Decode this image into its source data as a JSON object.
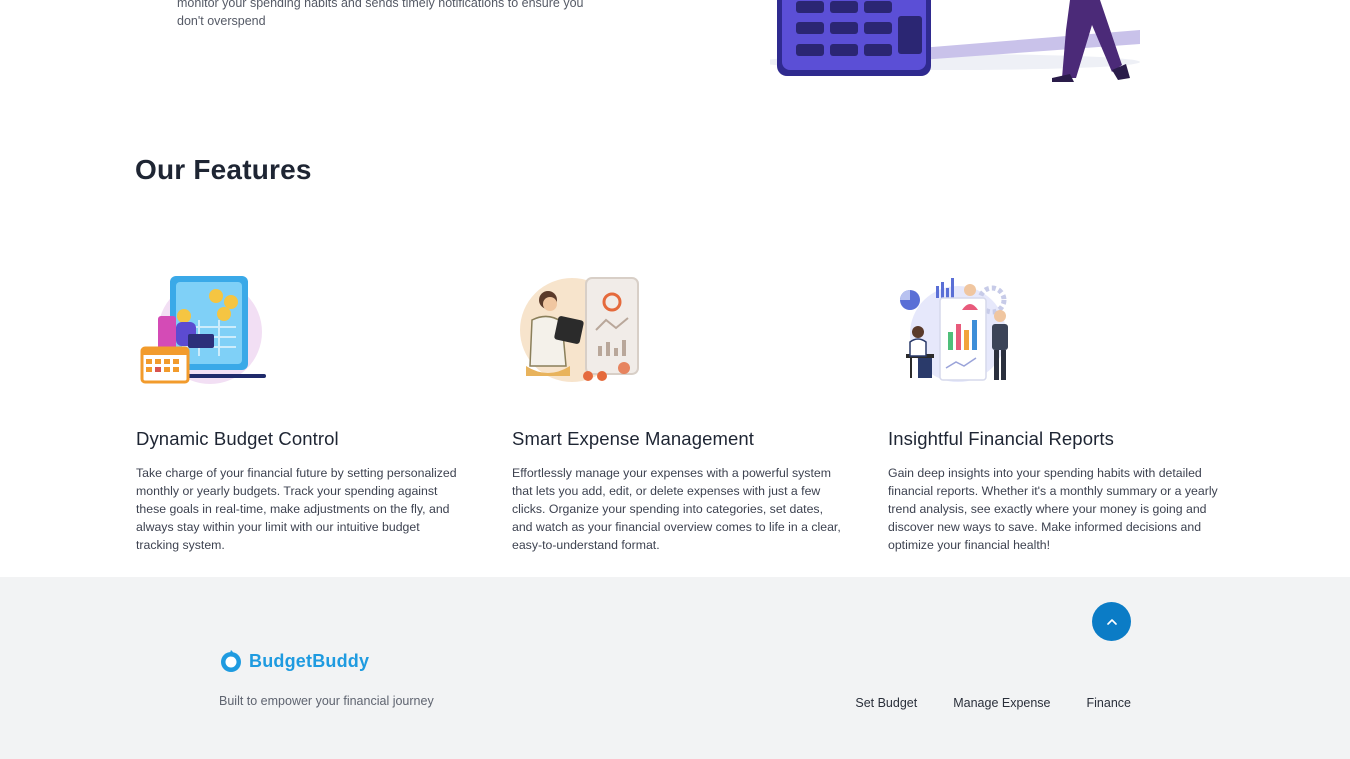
{
  "hero": {
    "text": "monitor your spending habits and sends timely notifications to ensure you don't overspend"
  },
  "features": {
    "title": "Our Features",
    "items": [
      {
        "title": "Dynamic Budget Control",
        "description": "Take charge of your financial future by setting personalized monthly or yearly budgets. Track your spending against these goals in real-time, make adjustments on the fly, and always stay within your limit with our intuitive budget tracking system.",
        "icon": "budget-calendar-illustration"
      },
      {
        "title": "Smart Expense Management",
        "description": "Effortlessly manage your expenses with a powerful system that lets you add, edit, or delete expenses with just a few clicks. Organize your spending into categories, set dates, and watch as your financial overview comes to life in a clear, easy-to-understand format.",
        "icon": "expense-tablet-illustration"
      },
      {
        "title": "Insightful Financial Reports",
        "description": "Gain deep insights into your spending habits with detailed financial reports. Whether it's a monthly summary or a yearly trend analysis, see exactly where your money is going and discover new ways to save. Make informed decisions and optimize your financial health!",
        "icon": "reports-chart-illustration"
      }
    ]
  },
  "footer": {
    "brand": "BudgetBuddy",
    "tagline": "Built to empower your financial journey",
    "links": [
      "Set Budget",
      "Manage Expense",
      "Finance"
    ],
    "back_to_top_icon": "chevron-up-icon"
  },
  "colors": {
    "brand": "#1f9be0",
    "back_to_top": "#0b7cc6",
    "footer_bg": "#f2f3f4"
  }
}
